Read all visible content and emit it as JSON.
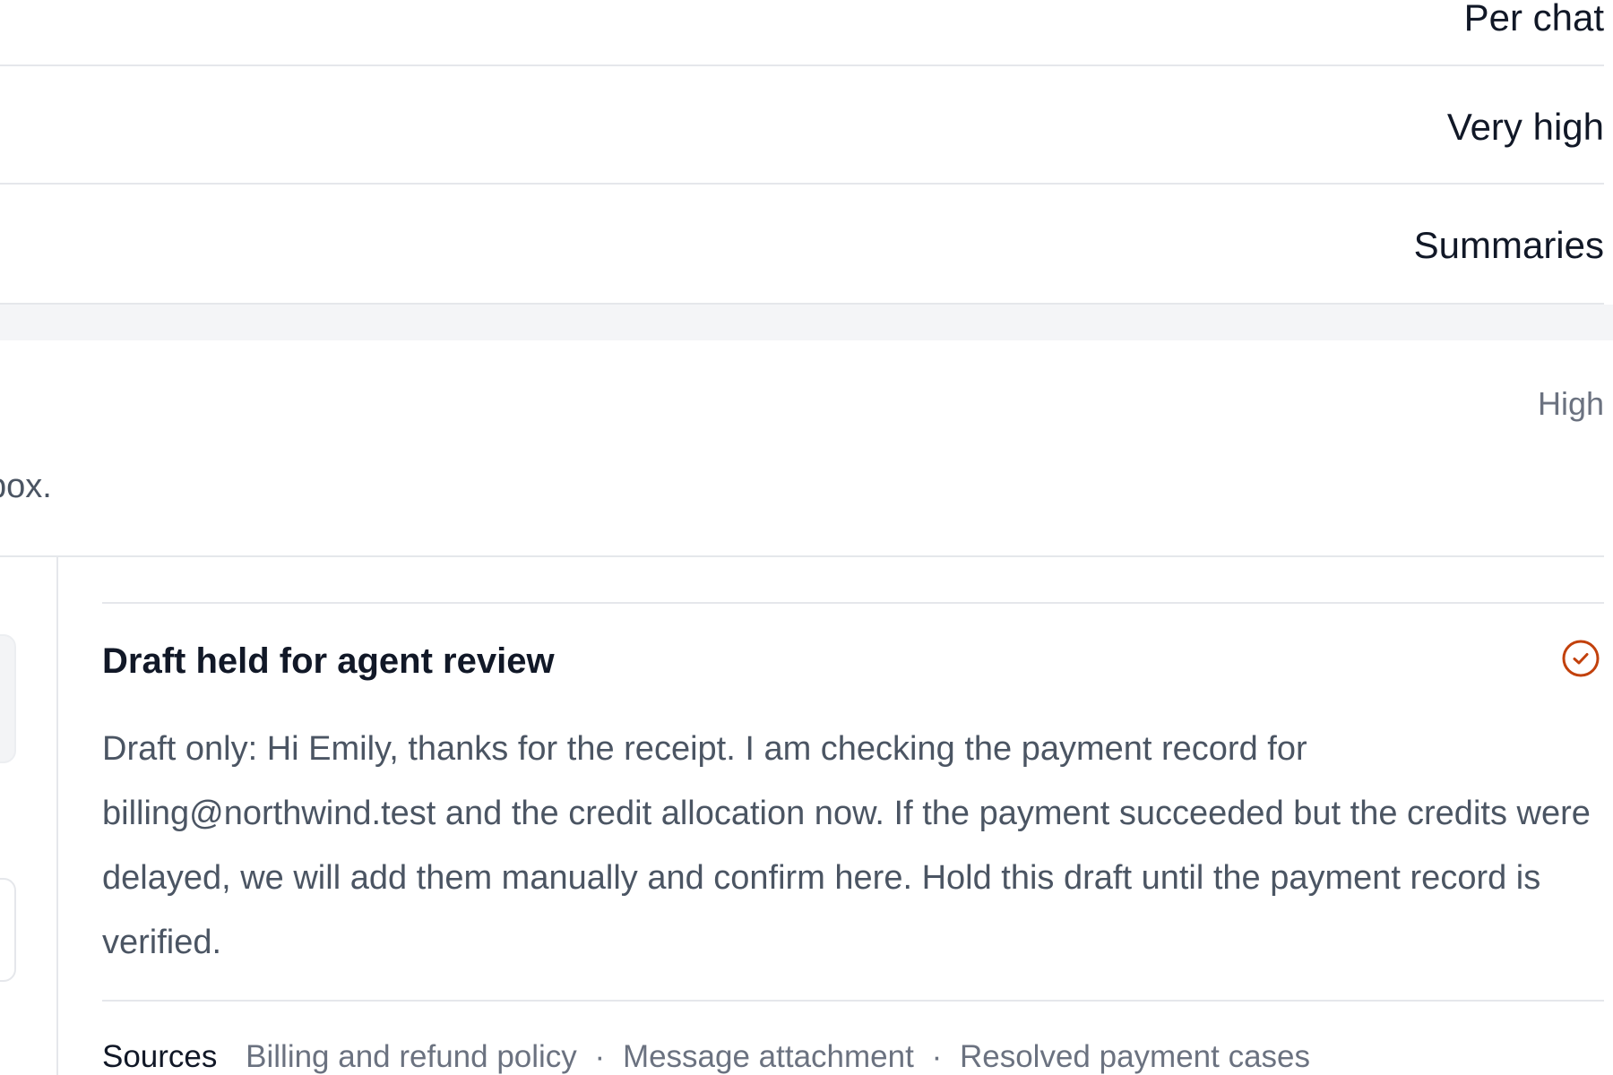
{
  "settings_rows": [
    {
      "value": "Per chat"
    },
    {
      "value": "Very high"
    },
    {
      "value": "Summaries"
    }
  ],
  "priority": {
    "value": "High"
  },
  "fragment": {
    "text": "box."
  },
  "draft": {
    "title": "Draft held for agent review",
    "status_icon": "check-circle-icon",
    "body": "Draft only: Hi Emily, thanks for the receipt. I am checking the payment record for billing@northwind.test and the credit allocation now. If the payment succeeded but the credits were delayed, we will add them manually and confirm here. Hold this draft until the payment record is verified.",
    "sources_label": "Sources",
    "sources": [
      "Billing and refund policy",
      "Message attachment",
      "Resolved payment cases"
    ],
    "source_separator": "·"
  },
  "colors": {
    "accent": "#c2410c",
    "text_primary": "#111827",
    "text_secondary": "#4b5563",
    "text_muted": "#6b7280",
    "divider": "#e5e7eb",
    "band": "#f4f5f7"
  }
}
